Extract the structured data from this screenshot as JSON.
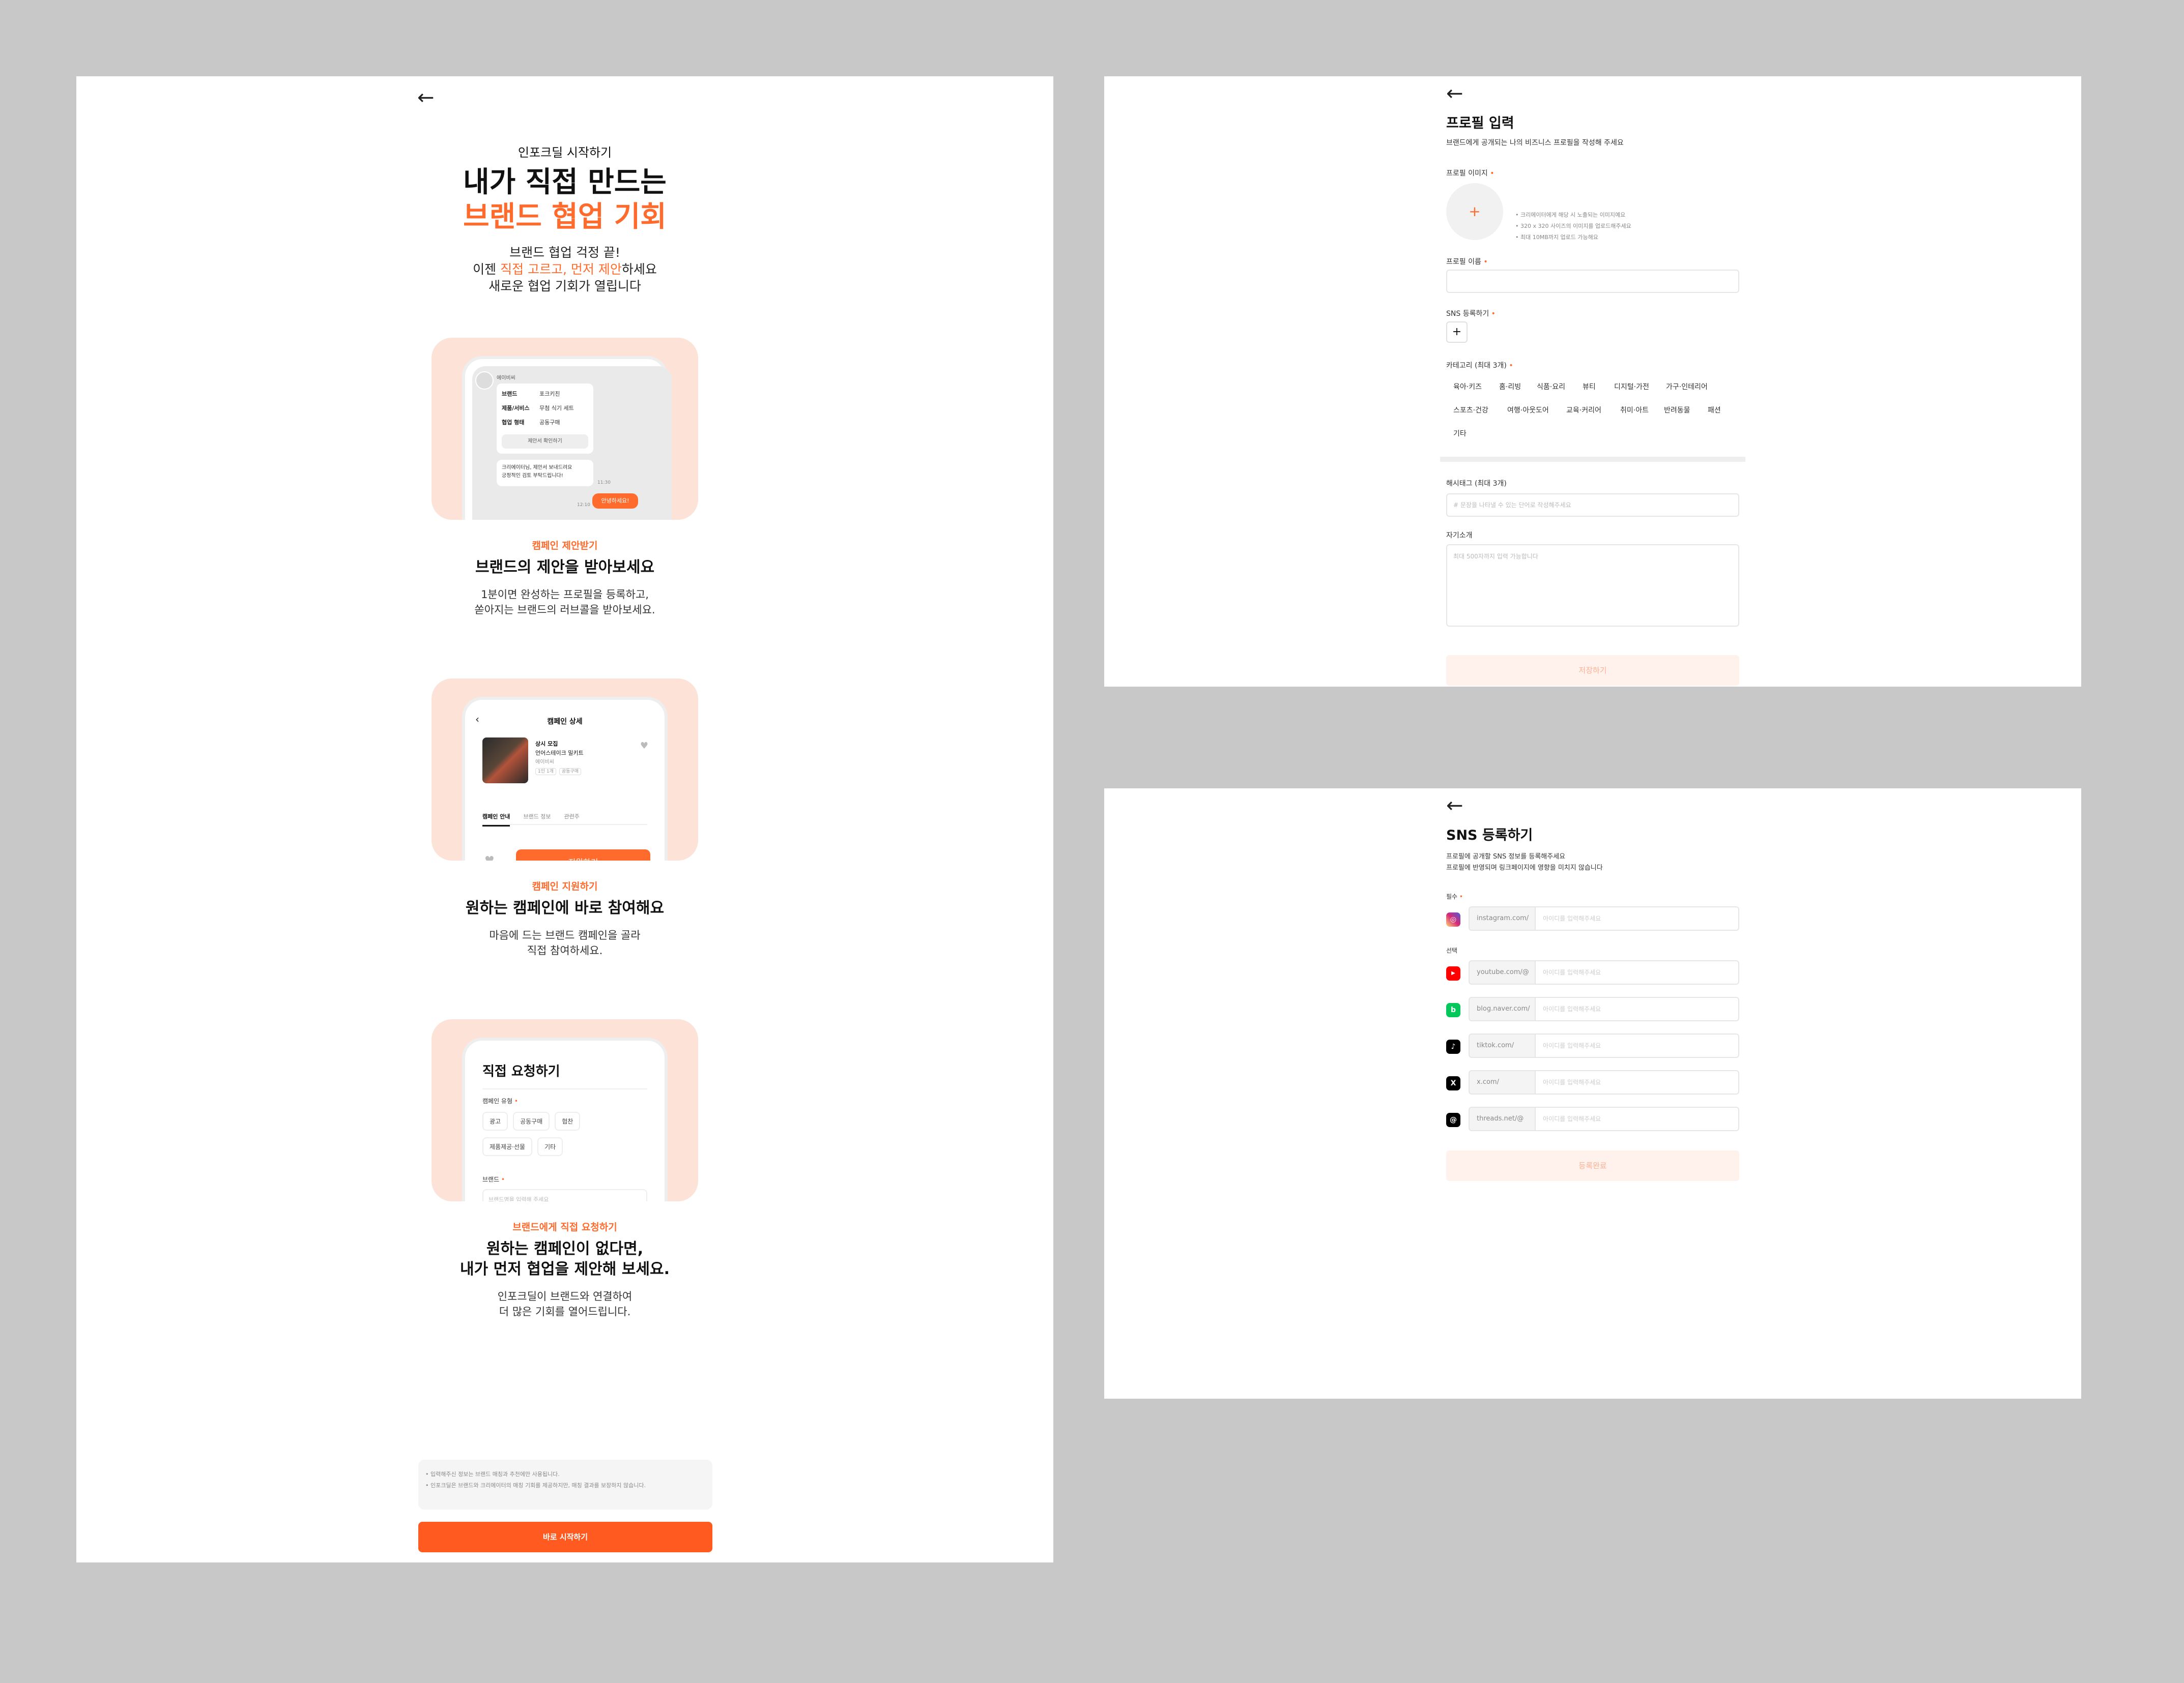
{
  "colors": {
    "accent": "#ff6b2c",
    "cta": "#ff5a1f",
    "card_bg": "#fde3d7",
    "canvas": "#c8c8c8"
  },
  "onboarding": {
    "back_icon": "arrow-left-icon",
    "kicker": "인포크딜 시작하기",
    "title_line1": "내가 직접 만드는",
    "title_line2": "브랜드 협업 기회",
    "desc_line1": "브랜드 협업 걱정 끝!",
    "desc_line2_pre": "이젠 ",
    "desc_line2_hl": "직접 고르고, 먼저 제안",
    "desc_line2_post": "하세요",
    "desc_line3": "새로운 협업 기회가 열립니다",
    "section1": {
      "kicker": "캠페인 제안받기",
      "title": "브랜드의 제안을 받아보세요",
      "desc_line1": "1분이면 완성하는 프로필을 등록하고,",
      "desc_line2": "쏟아지는 브랜드의 러브콜을 받아보세요.",
      "mock": {
        "sender": "에이비씨",
        "brand_label": "브랜드",
        "brand_value": "포크키친",
        "product_label": "제품/서비스",
        "product_value": "무첨 식기 세트",
        "type_label": "협업 형태",
        "type_value": "공동구매",
        "view_button": "제안서 확인하기",
        "message_line1": "크리에이터님, 제안서 보내드려요",
        "message_line2": "긍정적인 검토 부탁드립니다!",
        "time1": "11:30",
        "reply": "안녕하세요!",
        "time2": "12:10"
      }
    },
    "section2": {
      "kicker": "캠페인 지원하기",
      "title": "원하는 캠페인에 바로 참여해요",
      "desc_line1": "마음에 드는 브랜드 캠페인을 골라",
      "desc_line2": "직접 참여하세요.",
      "mock": {
        "header": "캠페인 상세",
        "recruit": "상시 모집",
        "name": "언어스테이크 밀키트",
        "brand": "에이비씨",
        "tags": "1인 1개",
        "tags2": "공동구매",
        "tab1": "캠페인 안내",
        "tab2": "브랜드 정보",
        "tab3": "관련주",
        "apply": "지원하기"
      }
    },
    "section3": {
      "kicker": "브랜드에게 직접 요청하기",
      "title_line1": "원하는 캠페인이 없다면,",
      "title_line2": "내가 먼저 협업을 제안해 보세요.",
      "desc_line1": "인포크딜이 브랜드와 연결하여",
      "desc_line2": "더 많은 기회를 열어드립니다.",
      "mock": {
        "title": "직접 요청하기",
        "type_label": "캠페인 유형",
        "chips": [
          "광고",
          "공동구매",
          "협찬",
          "제품제공·선물",
          "기타"
        ],
        "brand_label": "브랜드",
        "brand_placeholder": "브랜드명을 입력해 주세요"
      }
    },
    "notice_line1": "• 입력해주신 정보는 브랜드 매칭과 추천에만 사용됩니다.",
    "notice_line2": "• 인포크딜은 브랜드와 크리에이터의 매칭 기회를 제공하지만, 매칭 결과를 보장하지 않습니다.",
    "cta": "바로 시작하기"
  },
  "profile": {
    "back_icon": "arrow-left-icon",
    "title": "프로필 입력",
    "subtitle": "브랜드에게 공개되는 나의 비즈니스 프로필을 작성해 주세요",
    "image_label": "프로필 이미지",
    "image_hints": [
      "• 크리에이터에게 해당 시 노출되는 이미지예요",
      "• 320 x 320 사이즈의 이미지를 업로드해주세요",
      "• 최대 10MB까지 업로드 가능해요"
    ],
    "name_label": "프로필 이름",
    "sns_label": "SNS 등록하기",
    "category_label": "카테고리 (최대 3개)",
    "categories": [
      "육아·키즈",
      "홈·리빙",
      "식품·요리",
      "뷰티",
      "디지털·가전",
      "가구·인테리어",
      "스포츠·건강",
      "여행·아웃도어",
      "교육·커리어",
      "취미·아트",
      "반려동물",
      "패션",
      "기타"
    ],
    "hashtag_label": "해시태그 (최대 3개)",
    "hashtag_placeholder": "# 문장을 나타낼 수 있는 단어로 작성해주세요",
    "intro_label": "자기소개",
    "intro_placeholder": "최대 500자까지 입력 가능합니다",
    "save": "저장하기"
  },
  "sns": {
    "back_icon": "arrow-left-icon",
    "title": "SNS 등록하기",
    "subtitle_line1": "프로필에 공개할 SNS 정보를 등록해주세요",
    "subtitle_line2": "프로필에 반영되며 링크페이지에 영향을 미치지 않습니다",
    "required_label": "필수",
    "optional_label": "선택",
    "rows": [
      {
        "icon": "instagram-icon",
        "color": "#d62976",
        "glyph": "◎",
        "prefix": "instagram.com/",
        "placeholder": "아이디를 입력해주세요"
      },
      {
        "icon": "youtube-icon",
        "color": "#ff0000",
        "glyph": "▶",
        "prefix": "youtube.com/@",
        "placeholder": "아이디를 입력해주세요"
      },
      {
        "icon": "naver-blog-icon",
        "color": "#03c75a",
        "glyph": "b",
        "prefix": "blog.naver.com/",
        "placeholder": "아이디를 입력해주세요"
      },
      {
        "icon": "tiktok-icon",
        "color": "#000000",
        "glyph": "♪",
        "prefix": "tiktok.com/",
        "placeholder": "아이디를 입력해주세요"
      },
      {
        "icon": "x-icon",
        "color": "#000000",
        "glyph": "X",
        "prefix": "x.com/",
        "placeholder": "아이디를 입력해주세요"
      },
      {
        "icon": "threads-icon",
        "color": "#000000",
        "glyph": "@",
        "prefix": "threads.net/@",
        "placeholder": "아이디를 입력해주세요"
      }
    ],
    "submit": "등록완료"
  }
}
